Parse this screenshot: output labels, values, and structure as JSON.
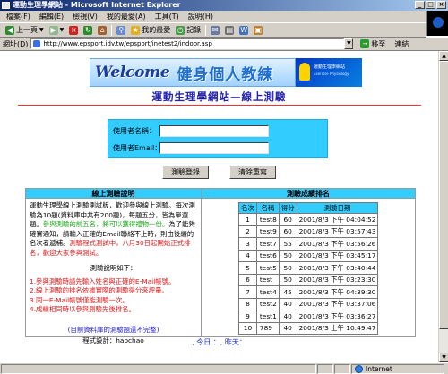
{
  "window": {
    "title": "運動生理學網站 - Microsoft Internet Explorer",
    "controls": [
      "_",
      "□",
      "×"
    ]
  },
  "menubar": [
    "檔案(F)",
    "編輯(E)",
    "檢視(V)",
    "我的最愛(A)",
    "工具(T)",
    "說明(H)"
  ],
  "toolbar": {
    "back": "上一頁",
    "favorites": "我的最愛",
    "history": "記錄"
  },
  "addressbar": {
    "label": "網址(D)",
    "url": "http://www.epsport.idv.tw/epsport/inetest2/indoor.asp",
    "go": "移至",
    "links": "連結"
  },
  "banner": {
    "welcome": "Welcome",
    "title": "健身個人教練",
    "site_name": "運動生理學網站",
    "site_sub": "Exercise Physiology"
  },
  "page": {
    "heading": "運動生理學網站—線上測驗"
  },
  "login": {
    "name_label": "使用者名稱：",
    "name_value": "",
    "email_label": "使用者Email：",
    "email_value": "",
    "submit": "測驗登錄",
    "reset": "清除重寫"
  },
  "instructions": {
    "header": "線上測驗說明",
    "p1_a": "運動生理學線上測驗測試版，歡迎參與線上測驗。每次測驗為10題(資料庫中共有200題)，每題五分，皆為單選題。",
    "p1_green": "參與測驗的前五名，將可以獲得禮物一份。",
    "p1_b": "為了能夠確實通知，請輸入正確的Email聯絡不上時，則由後續的名次者遞補。",
    "p1_red": "測驗程式測試中，八月30日起開始正式排名，歡迎大家參與測試。",
    "rules_title": "測驗說明如下：",
    "rules": [
      "1.參與測驗時請先輸入姓名與正確的E-Mail帳號。",
      "2.線上測驗的排名依據實際的測驗得分來評量。",
      "3.同一E-Mail帳號僅能測驗一次。",
      "4.成績相同時以參與測驗先後排名。"
    ],
    "footnote": "(目前資料庫的測驗題還不完整)",
    "credit": "程式設計：haochao"
  },
  "scores": {
    "header": "測驗成績排名",
    "columns": [
      "名次",
      "名稱",
      "得分",
      "測驗日期"
    ],
    "rows": [
      [
        "1",
        "test8",
        "60",
        "2001/8/3 下午 04:04:52"
      ],
      [
        "2",
        "test9",
        "60",
        "2001/8/3 下午 03:57:43"
      ],
      [
        "3",
        "test7",
        "55",
        "2001/8/3 下午 03:56:26"
      ],
      [
        "4",
        "test6",
        "50",
        "2001/8/3 下午 03:45:17"
      ],
      [
        "5",
        "test5",
        "50",
        "2001/8/3 下午 03:40:44"
      ],
      [
        "6",
        "test",
        "50",
        "2001/8/3 下午 03:23:30"
      ],
      [
        "7",
        "test4",
        "45",
        "2001/8/3 下午 04:39:30"
      ],
      [
        "8",
        "test2",
        "40",
        "2001/8/3 下午 03:37:06"
      ],
      [
        "9",
        "test1",
        "40",
        "2001/8/3 下午 03:36:27"
      ],
      [
        "10",
        "789",
        "40",
        "2001/8/3 上午 10:49:47"
      ]
    ]
  },
  "counter": {
    "text": ", 今日 ：, 昨天："
  },
  "statusbar": {
    "zone": "Internet"
  }
}
